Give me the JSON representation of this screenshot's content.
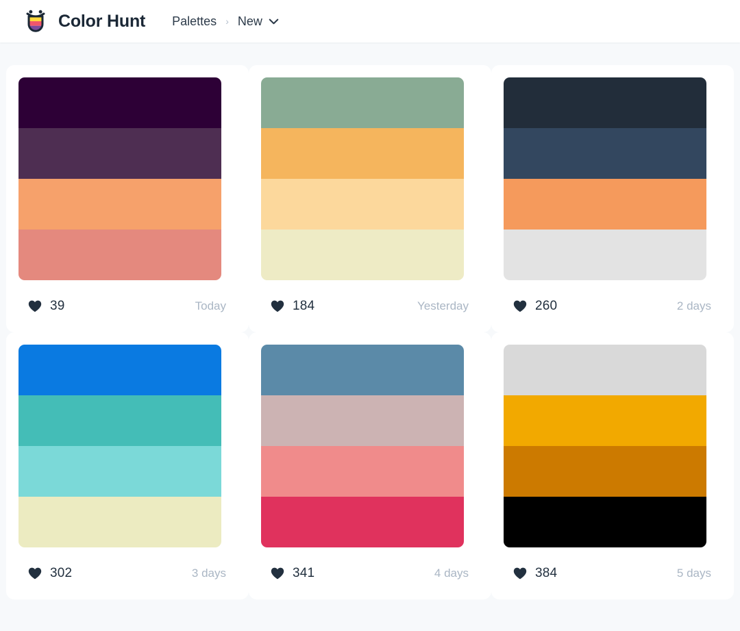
{
  "header": {
    "logo_icon": "colorhunt-shield-smile-logo",
    "brand_title": "Color Hunt",
    "breadcrumb": {
      "root_label": "Palettes",
      "separator": "›",
      "current_label": "New",
      "dropdown_icon": "chevron-down-icon"
    }
  },
  "theme": {
    "page_background": "#f7f9fb",
    "card_background": "#ffffff",
    "text_primary": "#22303f",
    "text_muted": "#aab6c4",
    "heart_color": "#22303f"
  },
  "palettes": [
    {
      "colors": [
        "#2d0036",
        "#4e2e52",
        "#f6a16b",
        "#e4897e"
      ],
      "likes": "39",
      "date": "Today",
      "heart_icon": "heart-icon"
    },
    {
      "colors": [
        "#89ab94",
        "#f5b55d",
        "#fcd89c",
        "#eeebc5"
      ],
      "likes": "184",
      "date": "Yesterday",
      "heart_icon": "heart-icon"
    },
    {
      "colors": [
        "#222d3a",
        "#33475f",
        "#f59a5c",
        "#e3e3e3"
      ],
      "likes": "260",
      "date": "2 days",
      "heart_icon": "heart-icon"
    },
    {
      "colors": [
        "#0a7ae1",
        "#44bdb7",
        "#7bd9d8",
        "#ecebc1"
      ],
      "likes": "302",
      "date": "3 days",
      "heart_icon": "heart-icon"
    },
    {
      "colors": [
        "#5b8aa8",
        "#ccb3b3",
        "#f08b8b",
        "#e0325d"
      ],
      "likes": "341",
      "date": "4 days",
      "heart_icon": "heart-icon"
    },
    {
      "colors": [
        "#d9d9d9",
        "#f2a900",
        "#cc7a00",
        "#000000"
      ],
      "likes": "384",
      "date": "5 days",
      "heart_icon": "heart-icon"
    }
  ]
}
